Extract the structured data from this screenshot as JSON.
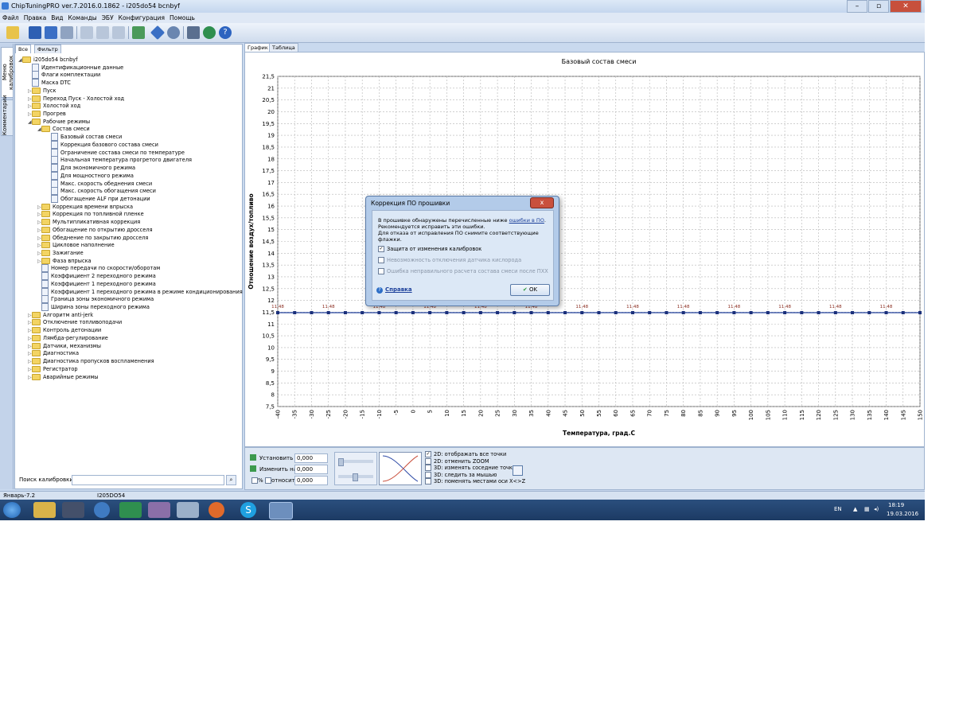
{
  "window": {
    "title": "ChipTuningPRO ver.7.2016.0.1862 - i205do54 bcnbyf"
  },
  "menu": [
    "Файл",
    "Правка",
    "Вид",
    "Команды",
    "ЭБУ",
    "Конфигурация",
    "Помощь"
  ],
  "left_tabs": [
    "Меню калибровок",
    "Комментарии"
  ],
  "tree_tabs": [
    "Все",
    "Фильтр"
  ],
  "tree": [
    {
      "label": "i205do54 bcnbyf",
      "level": 0,
      "kind": "folder",
      "exp": "◢"
    },
    {
      "label": "Идентификационные данные",
      "level": 1,
      "kind": "doc",
      "exp": ""
    },
    {
      "label": "Флаги комплектации",
      "level": 1,
      "kind": "doc",
      "exp": ""
    },
    {
      "label": "Маска DTC",
      "level": 1,
      "kind": "doc",
      "exp": ""
    },
    {
      "label": "Пуск",
      "level": 1,
      "kind": "folder",
      "exp": "▷"
    },
    {
      "label": "Переход Пуск - Холостой ход",
      "level": 1,
      "kind": "folder",
      "exp": "▷"
    },
    {
      "label": "Холостой ход",
      "level": 1,
      "kind": "folder",
      "exp": "▷"
    },
    {
      "label": "Прогрев",
      "level": 1,
      "kind": "folder",
      "exp": "▷"
    },
    {
      "label": "Рабочие режимы",
      "level": 1,
      "kind": "folder",
      "exp": "◢"
    },
    {
      "label": "Состав смеси",
      "level": 2,
      "kind": "folder",
      "exp": "◢"
    },
    {
      "label": "Базовый состав смеси",
      "level": 3,
      "kind": "doc",
      "exp": ""
    },
    {
      "label": "Коррекция базового состава смеси",
      "level": 3,
      "kind": "doc",
      "exp": ""
    },
    {
      "label": "Ограничение состава смеси по температуре",
      "level": 3,
      "kind": "doc",
      "exp": ""
    },
    {
      "label": "Начальная температура прогретого двигателя",
      "level": 3,
      "kind": "doc",
      "exp": ""
    },
    {
      "label": "Для экономичного режима",
      "level": 3,
      "kind": "doc",
      "exp": ""
    },
    {
      "label": "Для мощностного режима",
      "level": 3,
      "kind": "doc",
      "exp": ""
    },
    {
      "label": "Макс. скорость обеднения смеси",
      "level": 3,
      "kind": "doc",
      "exp": ""
    },
    {
      "label": "Макс. скорость обогащения смеси",
      "level": 3,
      "kind": "doc",
      "exp": ""
    },
    {
      "label": "Обогащение ALF при детонации",
      "level": 3,
      "kind": "doc",
      "exp": ""
    },
    {
      "label": "Коррекция времени впрыска",
      "level": 2,
      "kind": "folder",
      "exp": "▷"
    },
    {
      "label": "Коррекция по топливной пленке",
      "level": 2,
      "kind": "folder",
      "exp": "▷"
    },
    {
      "label": "Мультипликативная коррекция",
      "level": 2,
      "kind": "folder",
      "exp": "▷"
    },
    {
      "label": "Обогащение по открытию дросселя",
      "level": 2,
      "kind": "folder",
      "exp": "▷"
    },
    {
      "label": "Обеднение по закрытию дросселя",
      "level": 2,
      "kind": "folder",
      "exp": "▷"
    },
    {
      "label": "Цикловое наполнение",
      "level": 2,
      "kind": "folder",
      "exp": "▷"
    },
    {
      "label": "Зажигание",
      "level": 2,
      "kind": "folder",
      "exp": "▷"
    },
    {
      "label": "Фаза впрыска",
      "level": 2,
      "kind": "folder",
      "exp": "▷"
    },
    {
      "label": "Номер передачи по скорости/оборотам",
      "level": 2,
      "kind": "doc",
      "exp": ""
    },
    {
      "label": "Коэффициент 2 переходного режима",
      "level": 2,
      "kind": "doc",
      "exp": ""
    },
    {
      "label": "Коэффициент 1 переходного режима",
      "level": 2,
      "kind": "doc",
      "exp": ""
    },
    {
      "label": "Коэффициент 1 переходного режима в режиме кондиционирования",
      "level": 2,
      "kind": "doc",
      "exp": ""
    },
    {
      "label": "Граница зоны экономичного режима",
      "level": 2,
      "kind": "doc",
      "exp": ""
    },
    {
      "label": "Ширина зоны переходного режима",
      "level": 2,
      "kind": "doc",
      "exp": ""
    },
    {
      "label": "Алгоритм anti-jerk",
      "level": 1,
      "kind": "folder",
      "exp": "▷"
    },
    {
      "label": "Отключение топливоподачи",
      "level": 1,
      "kind": "folder",
      "exp": "▷"
    },
    {
      "label": "Контроль детонации",
      "level": 1,
      "kind": "folder",
      "exp": "▷"
    },
    {
      "label": "Лямбда-регулирование",
      "level": 1,
      "kind": "folder",
      "exp": "▷"
    },
    {
      "label": "Датчики, механизмы",
      "level": 1,
      "kind": "folder",
      "exp": "▷"
    },
    {
      "label": "Диагностика",
      "level": 1,
      "kind": "folder",
      "exp": "▷"
    },
    {
      "label": "Диагностика пропусков воспламенения",
      "level": 1,
      "kind": "folder",
      "exp": "▷"
    },
    {
      "label": "Регистратор",
      "level": 1,
      "kind": "folder",
      "exp": "▷"
    },
    {
      "label": "Аварийные режимы",
      "level": 1,
      "kind": "folder",
      "exp": "▷"
    }
  ],
  "search": {
    "label": "Поиск калибровки",
    "value": ""
  },
  "chart_tabs": [
    "График",
    "Таблица"
  ],
  "chart_data": {
    "type": "line",
    "title": "Базовый состав смеси",
    "xlabel": "Температура, град.С",
    "ylabel": "Отношение воздух/топливо",
    "x": [
      -40,
      -35,
      -30,
      -25,
      -20,
      -15,
      -10,
      -5,
      0,
      5,
      10,
      15,
      20,
      25,
      30,
      35,
      40,
      45,
      50,
      55,
      60,
      65,
      70,
      75,
      80,
      85,
      90,
      95,
      100,
      105,
      110,
      115,
      120,
      125,
      130,
      135,
      140,
      145,
      150
    ],
    "series": [
      {
        "values": [
          11.48,
          11.48,
          11.48,
          11.48,
          11.48,
          11.48,
          11.48,
          11.48,
          11.48,
          11.48,
          11.48,
          11.48,
          11.48,
          11.48,
          11.48,
          11.48,
          11.48,
          11.48,
          11.48,
          11.48,
          11.48,
          11.48,
          11.48,
          11.48,
          11.48,
          11.48,
          11.48,
          11.48,
          11.48,
          11.48,
          11.48,
          11.48,
          11.48,
          11.48,
          11.48,
          11.48,
          11.48,
          11.48,
          11.48
        ]
      }
    ],
    "point_labels": "11,48",
    "xlim": [
      -40,
      150
    ],
    "ylim": [
      7.5,
      21.5
    ],
    "yticks": [
      "7,5",
      "8",
      "8,5",
      "9",
      "9,5",
      "10",
      "10,5",
      "11",
      "11,5",
      "12",
      "12,5",
      "13",
      "13,5",
      "14",
      "14,5",
      "15",
      "15,5",
      "16",
      "16,5",
      "17",
      "17,5",
      "18",
      "18,5",
      "19",
      "19,5",
      "20",
      "20,5",
      "21",
      "21,5"
    ],
    "grid": true,
    "line_color": "#1f3f9b"
  },
  "controls": {
    "set_label": "Установить в",
    "set_value": "0,000",
    "change_label": "Изменить на",
    "change_value": "0,000",
    "percent_label": "%",
    "relative_label": "относит.",
    "relative_value": "0,000",
    "options": [
      {
        "label": "2D: отображать все точки",
        "checked": true
      },
      {
        "label": "2D: отменить ZOOM",
        "checked": false
      },
      {
        "label": "3D: изменять соседние точки",
        "checked": false
      },
      {
        "label": "3D: следить за мышью",
        "checked": false
      },
      {
        "label": "3D: поменять местами оси X<>Z",
        "checked": false
      }
    ]
  },
  "status": {
    "left": "Январь-7.2",
    "middle": "I205DO54"
  },
  "tray": {
    "lang": "EN",
    "time": "18:19",
    "date": "19.03.2016"
  },
  "dialog": {
    "title": "Коррекция ПО прошивки",
    "line1_prefix": "В прошивке обнаружены перечисленные ниже ",
    "line1_link": "ошибки в ПО",
    "line1_suffix": ".",
    "line2": "Рекомендуется исправить эти ошибки.",
    "line3": "Для отказа от исправления ПО снимите соответствующие флажки.",
    "checks": [
      {
        "label": "Защита от изменения калибровок",
        "checked": true,
        "enabled": true
      },
      {
        "label": "Невозможность отключения датчика кислорода",
        "checked": false,
        "enabled": false
      },
      {
        "label": "Ошибка неправильного расчета состава смеси после ПХХ",
        "checked": false,
        "enabled": false
      }
    ],
    "help": "Справка",
    "ok": "OK",
    "close": "x"
  },
  "colors": {
    "accent": "#3a6fc4",
    "close": "#c9503d",
    "line": "#1f3f9b"
  }
}
